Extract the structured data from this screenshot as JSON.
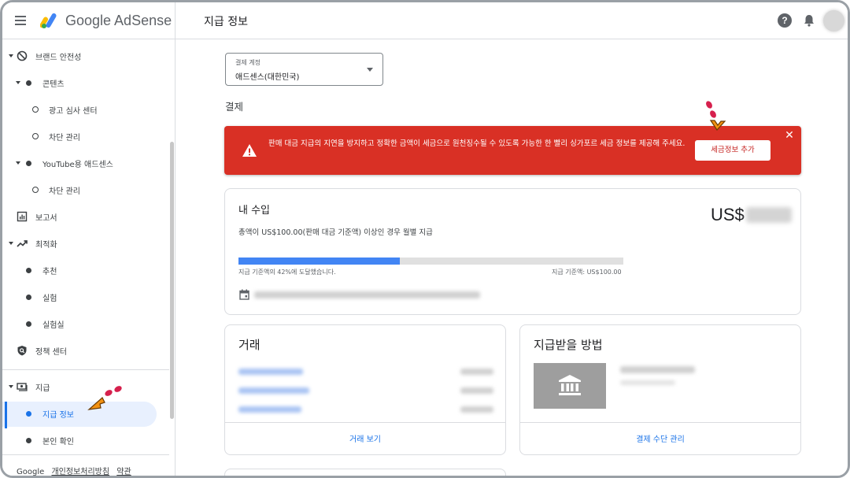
{
  "header": {
    "brand": "Google AdSense",
    "page_title": "지급 정보"
  },
  "sidebar": {
    "items": [
      {
        "label": "브랜드 안전성"
      },
      {
        "label": "콘텐츠"
      },
      {
        "label": "광고 심사 센터"
      },
      {
        "label": "차단 관리"
      },
      {
        "label": "YouTube용 애드센스"
      },
      {
        "label": "차단 관리"
      },
      {
        "label": "보고서"
      },
      {
        "label": "최적화"
      },
      {
        "label": "추천"
      },
      {
        "label": "실험"
      },
      {
        "label": "실험실"
      },
      {
        "label": "정책 센터"
      },
      {
        "label": "지급"
      },
      {
        "label": "지급 정보"
      },
      {
        "label": "본인 확인"
      }
    ],
    "footer": {
      "google": "Google",
      "privacy": "개인정보처리방침",
      "terms": "약관"
    }
  },
  "account_select": {
    "caption": "결제 계정",
    "value": "애드센스(대한민국)"
  },
  "section_title": "결제",
  "alert": {
    "message": "판매 대금 지급의 지연을 방지하고 정확한 금액이 세금으로 원천징수될 수 있도록 가능한 한 빨리 싱가포르 세금 정보를 제공해 주세요.",
    "button": "세금정보 추가",
    "close": "✕",
    "color": "#d93025"
  },
  "earnings": {
    "title": "내 수입",
    "currency": "US$",
    "description": "총액이 US$100.00(판매 대금 기준액) 이상인 경우 월별 지급",
    "progress": 0.42,
    "progress_left": "지급 기준액의 42%에 도달했습니다.",
    "progress_right": "지급 기준액: US$100.00"
  },
  "transactions": {
    "title": "거래",
    "link": "거래 보기"
  },
  "payment_methods": {
    "title": "지급받을 방법",
    "link": "결제 수단 관리"
  },
  "colors": {
    "accent": "#1a73e8",
    "progress": "#4285f4",
    "alert": "#d93025",
    "pointer": "#f29111",
    "pointer_dots": "#d6204d"
  }
}
